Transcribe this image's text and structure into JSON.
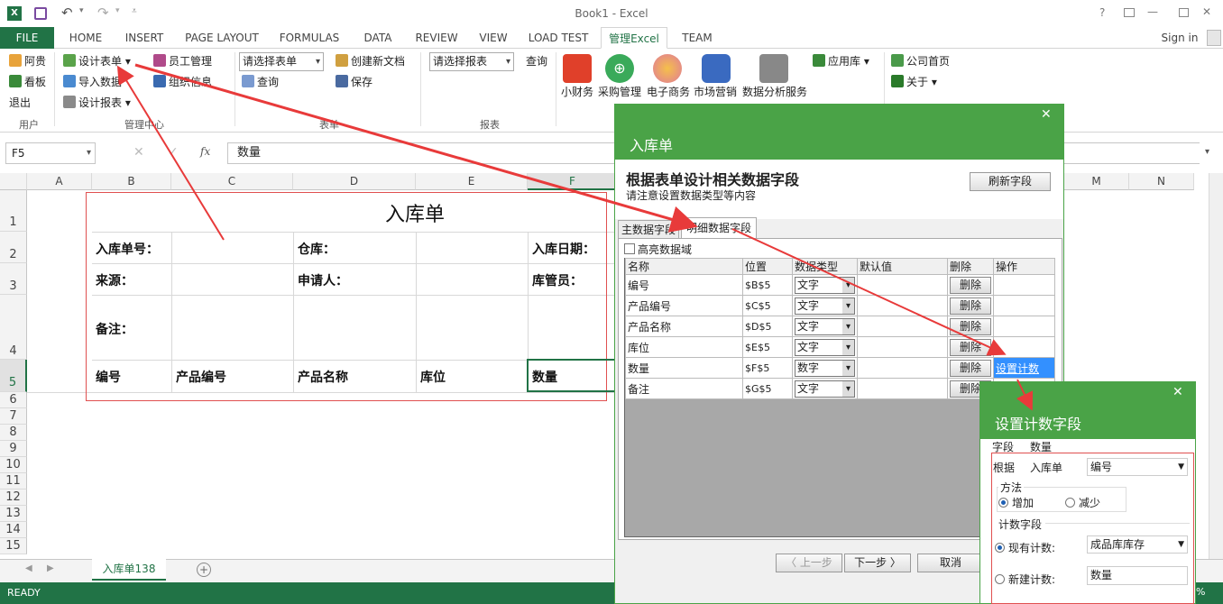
{
  "title": "Book1 - Excel",
  "title_controls": [
    "?",
    "—",
    "✕"
  ],
  "tabs": [
    "FILE",
    "HOME",
    "INSERT",
    "PAGE LAYOUT",
    "FORMULAS",
    "DATA",
    "REVIEW",
    "VIEW",
    "LOAD TEST",
    "管理Excel",
    "TEAM"
  ],
  "signin": "Sign in",
  "ribbon": {
    "user_group": {
      "label": "用户",
      "items": [
        "阿贵",
        "看板",
        "退出"
      ]
    },
    "mgmt_group": {
      "label": "管理中心",
      "design_form": "设计表单",
      "import_data": "导入数据",
      "design_report": "设计报表",
      "staff": "员工管理",
      "org": "组织信息"
    },
    "form_group": {
      "label": "表单",
      "select_form": "请选择表单",
      "query": "查询",
      "new_doc": "创建新文档",
      "save": "保存"
    },
    "report_group": {
      "label": "报表",
      "select_report": "请选择报表",
      "query": "查询"
    },
    "apps": [
      "小财务",
      "采购管理",
      "电子商务",
      "市场营销",
      "数据分析服务"
    ],
    "app_library": "应用库",
    "company": {
      "home": "公司首页",
      "about": "关于"
    }
  },
  "formula": {
    "namebox": "F5",
    "value": "数量",
    "fx": "fx"
  },
  "columns": [
    "A",
    "B",
    "C",
    "D",
    "E",
    "F",
    "M",
    "N"
  ],
  "rows": [
    "1",
    "2",
    "3",
    "4",
    "5",
    "6",
    "7",
    "8",
    "9",
    "10",
    "11",
    "12",
    "13",
    "14",
    "15"
  ],
  "form": {
    "title": "入库单",
    "order_no": "入库单号：",
    "warehouse": "仓库：",
    "date": "入库日期：",
    "source": "来源：",
    "applicant": "申请人：",
    "keeper": "库管员：",
    "remark": "备注：",
    "detail_headers": [
      "编号",
      "产品编号",
      "产品名称",
      "库位",
      "数量"
    ]
  },
  "sheet_tab": "入库单138",
  "status": "READY",
  "status_zoom": "%",
  "dialog1": {
    "title": "入库单",
    "heading": "根据表单设计相关数据字段",
    "subheading": "请注意设置数据类型等内容",
    "refresh": "刷新字段",
    "tabs": [
      "主数据字段",
      "明细数据字段"
    ],
    "highlight": "高亮数据域",
    "headers": [
      "名称",
      "位置",
      "数据类型",
      "默认值",
      "删除",
      "操作"
    ],
    "rows": [
      {
        "name": "编号",
        "pos": "$B$5",
        "type": "文字"
      },
      {
        "name": "产品编号",
        "pos": "$C$5",
        "type": "文字"
      },
      {
        "name": "产品名称",
        "pos": "$D$5",
        "type": "文字"
      },
      {
        "name": "库位",
        "pos": "$E$5",
        "type": "文字"
      },
      {
        "name": "数量",
        "pos": "$F$5",
        "type": "数字",
        "action": "设置计数"
      },
      {
        "name": "备注",
        "pos": "$G$5",
        "type": "文字"
      }
    ],
    "delete_label": "删除",
    "prev": "〈 上一步",
    "next": "下一步 〉",
    "cancel": "取消"
  },
  "dialog2": {
    "title": "设置计数字段",
    "field_label": "字段",
    "field_value": "数量",
    "basis_label": "根据",
    "basis_form": "入库单",
    "basis_field": "编号",
    "method_label": "方法",
    "increase": "增加",
    "decrease": "减少",
    "count_label": "计数字段",
    "existing": "现有计数:",
    "existing_value": "成品库库存",
    "new_count": "新建计数:",
    "new_value": "数量"
  },
  "colors": {
    "excel_green": "#217346",
    "dialog_green": "#4aa347",
    "arrow_red": "#e83a3a"
  }
}
